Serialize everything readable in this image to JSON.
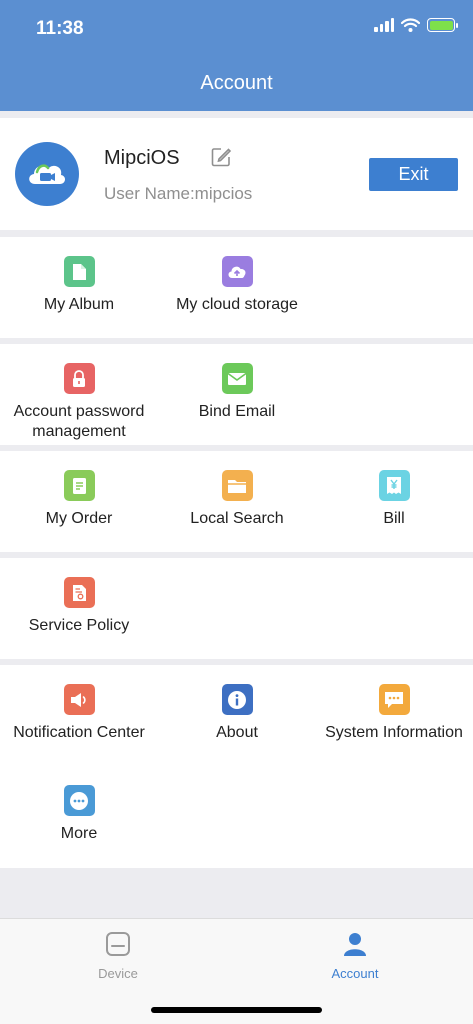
{
  "status_bar": {
    "time": "11:38"
  },
  "header": {
    "title": "Account"
  },
  "profile": {
    "nickname": "MipciOS",
    "username": "User Name:mipcios",
    "exit_label": "Exit"
  },
  "sections": [
    {
      "items": [
        {
          "label": "My Album",
          "icon": "file-icon",
          "color": "#5cc48a"
        },
        {
          "label": "My cloud storage",
          "icon": "cloud-upload-icon",
          "color": "#9a7de0"
        }
      ]
    },
    {
      "items": [
        {
          "label": "Account password management",
          "icon": "lock-icon",
          "color": "#e76464"
        },
        {
          "label": "Bind Email",
          "icon": "envelope-icon",
          "color": "#6cc95a"
        }
      ]
    },
    {
      "items": [
        {
          "label": "My Order",
          "icon": "order-list-icon",
          "color": "#8acb5a"
        },
        {
          "label": "Local Search",
          "icon": "folder-icon",
          "color": "#f3b04f"
        },
        {
          "label": "Bill",
          "icon": "yen-receipt-icon",
          "color": "#6bd3e3"
        }
      ]
    },
    {
      "items": [
        {
          "label": "Service Policy",
          "icon": "policy-document-icon",
          "color": "#ea6f56"
        }
      ]
    },
    {
      "items": [
        {
          "label": "Notification Center",
          "icon": "speaker-icon",
          "color": "#ea6f56"
        },
        {
          "label": "About",
          "icon": "info-icon",
          "color": "#3d6fc2"
        },
        {
          "label": "System Information",
          "icon": "message-icon",
          "color": "#f3a93c"
        },
        {
          "label": "More",
          "icon": "more-dots-icon",
          "color": "#4a9ad6"
        }
      ]
    }
  ],
  "tabbar": {
    "tabs": [
      {
        "label": "Device",
        "icon": "device-icon",
        "active": false
      },
      {
        "label": "Account",
        "icon": "person-icon",
        "active": true
      }
    ],
    "active_color": "#3d7fd0",
    "inactive_color": "#9a9a9a"
  },
  "colors": {
    "header": "#5b8fd1",
    "accent": "#3d7fd0",
    "background": "#ececf0"
  }
}
